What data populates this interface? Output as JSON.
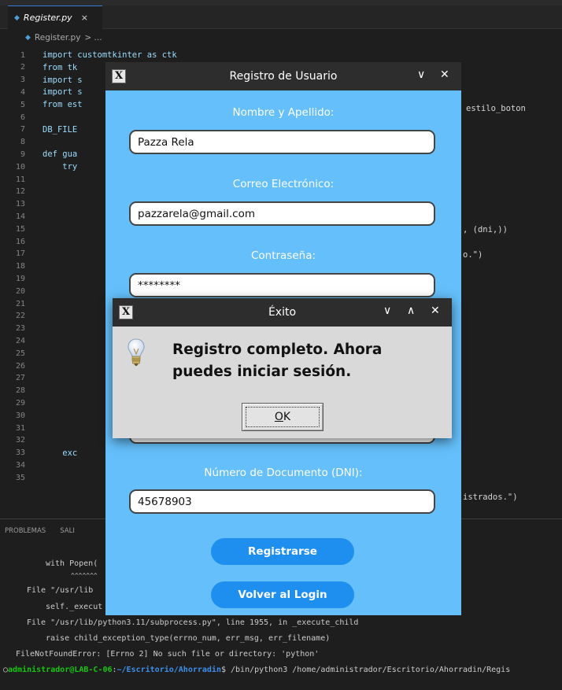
{
  "editor": {
    "tab_label": "Register.py",
    "tab_close": "×",
    "breadcrumb_file": "Register.py",
    "breadcrumb_rest": "> ...",
    "lines": [
      {
        "n": "1",
        "code": "import customtkinter as ctk"
      },
      {
        "n": "2",
        "code": "from tk"
      },
      {
        "n": "3",
        "code": "import s"
      },
      {
        "n": "4",
        "code": "import s"
      },
      {
        "n": "5",
        "code": "from est"
      },
      {
        "n": "6",
        "code": ""
      },
      {
        "n": "7",
        "code": "DB_FILE"
      },
      {
        "n": "8",
        "code": ""
      },
      {
        "n": "9",
        "code": "def gua"
      },
      {
        "n": "10",
        "code": "    try"
      },
      {
        "n": "11",
        "code": ""
      },
      {
        "n": "12",
        "code": ""
      },
      {
        "n": "13",
        "code": ""
      },
      {
        "n": "14",
        "code": ""
      },
      {
        "n": "15",
        "code": ""
      },
      {
        "n": "16",
        "code": ""
      },
      {
        "n": "17",
        "code": ""
      },
      {
        "n": "18",
        "code": ""
      },
      {
        "n": "19",
        "code": ""
      },
      {
        "n": "20",
        "code": ""
      },
      {
        "n": "21",
        "code": ""
      },
      {
        "n": "22",
        "code": ""
      },
      {
        "n": "23",
        "code": ""
      },
      {
        "n": "24",
        "code": ""
      },
      {
        "n": "25",
        "code": ""
      },
      {
        "n": "26",
        "code": ""
      },
      {
        "n": "27",
        "code": ""
      },
      {
        "n": "28",
        "code": ""
      },
      {
        "n": "29",
        "code": ""
      },
      {
        "n": "30",
        "code": ""
      },
      {
        "n": "31",
        "code": ""
      },
      {
        "n": "32",
        "code": ""
      },
      {
        "n": "33",
        "code": "    exc"
      },
      {
        "n": "34",
        "code": ""
      },
      {
        "n": "35",
        "code": ""
      }
    ],
    "right_fragments": {
      "line5": "estilo_boton",
      "line14": ", (dni,))",
      "line16": "o.\")",
      "line34": "istrados.\")"
    }
  },
  "panel": {
    "tabs": [
      "PROBLEMAS",
      "SALI"
    ],
    "lines": [
      "with Popen(",
      "^^^^^^^",
      "File \"/usr/lib",
      "self._execut",
      "File \"/usr/lib/python3.11/subprocess.py\", line 1955, in _execute_child",
      "raise child_exception_type(errno_num, err_msg, err_filename)",
      "FileNotFoundError: [Errno 2] No such file or directory: 'python'"
    ],
    "prompt": {
      "marker": "○",
      "user": "administrador@LAB-C-06",
      "sep": ":",
      "path": "~/Escritorio/Ahorradin",
      "command": "$ /bin/python3 /home/administrador/Escritorio/Ahorradin/Regis"
    }
  },
  "register_window": {
    "title": "Registro de Usuario",
    "logo": "X",
    "minimize_glyph": "∨",
    "close_glyph": "✕",
    "fields": {
      "name_label": "Nombre y Apellido:",
      "name_value": "Pazza Rela",
      "email_label": "Correo Electrónico:",
      "email_value": "pazzarela@gmail.com",
      "password_label": "Contraseña:",
      "password_value": "********",
      "dni_label": "Número de Documento (DNI):",
      "dni_value": "45678903"
    },
    "register_button": "Registrarse",
    "back_button": "Volver al Login"
  },
  "dialog": {
    "title": "Éxito",
    "logo": "X",
    "minimize_glyph": "∨",
    "maximize_glyph": "∧",
    "close_glyph": "✕",
    "message": "Registro completo. Ahora puedes iniciar sesión.",
    "ok_mnemonic": "O",
    "ok_rest": "K",
    "icon": "lightbulb-icon"
  }
}
